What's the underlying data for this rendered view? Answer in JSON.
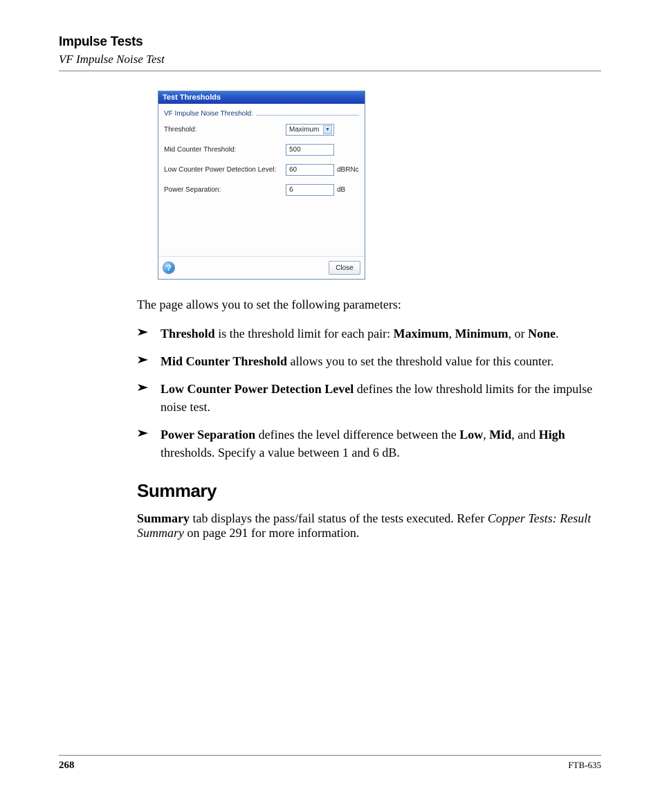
{
  "header": {
    "title": "Impulse Tests",
    "subtitle": "VF Impulse Noise Test"
  },
  "dialog": {
    "title": "Test Thresholds",
    "legend": "VF Impulse Noise Threshold:",
    "rows": {
      "threshold": {
        "label": "Threshold:",
        "value": "Maximum",
        "unit": ""
      },
      "mid": {
        "label": "Mid Counter Threshold:",
        "value": "500",
        "unit": ""
      },
      "low": {
        "label": "Low Counter Power Detection Level:",
        "value": "60",
        "unit": "dBRNc"
      },
      "power": {
        "label": "Power Separation:",
        "value": "6",
        "unit": "dB"
      }
    },
    "help": "?",
    "close": "Close"
  },
  "lead": "The page allows you to set the following parameters:",
  "bullets": {
    "b1": {
      "term": "Threshold",
      "rest1": " is the threshold limit for each pair: ",
      "max": "Maximum",
      "sep1": ", ",
      "min": "Minimum",
      "sep2": ", or ",
      "none": "None",
      "end": "."
    },
    "b2": {
      "term": "Mid Counter Threshold",
      "rest": " allows you to set the threshold value for this counter."
    },
    "b3": {
      "term": "Low Counter Power Detection Level",
      "rest": " defines the low threshold limits for the impulse noise test."
    },
    "b4": {
      "term": "Power Separation",
      "rest1": " defines the level difference between the ",
      "low": "Low",
      "sep1": ", ",
      "mid": "Mid",
      "sep2": ", and ",
      "high": "High",
      "rest2": " thresholds. Specify a value between 1 and 6 dB."
    }
  },
  "summary": {
    "heading": "Summary",
    "term": "Summary",
    "rest1": " tab displays the pass/fail status of the tests executed. Refer ",
    "ref": "Copper Tests: Result Summary",
    "rest2": " on page 291 for more information."
  },
  "footer": {
    "page": "268",
    "product": "FTB-635"
  }
}
